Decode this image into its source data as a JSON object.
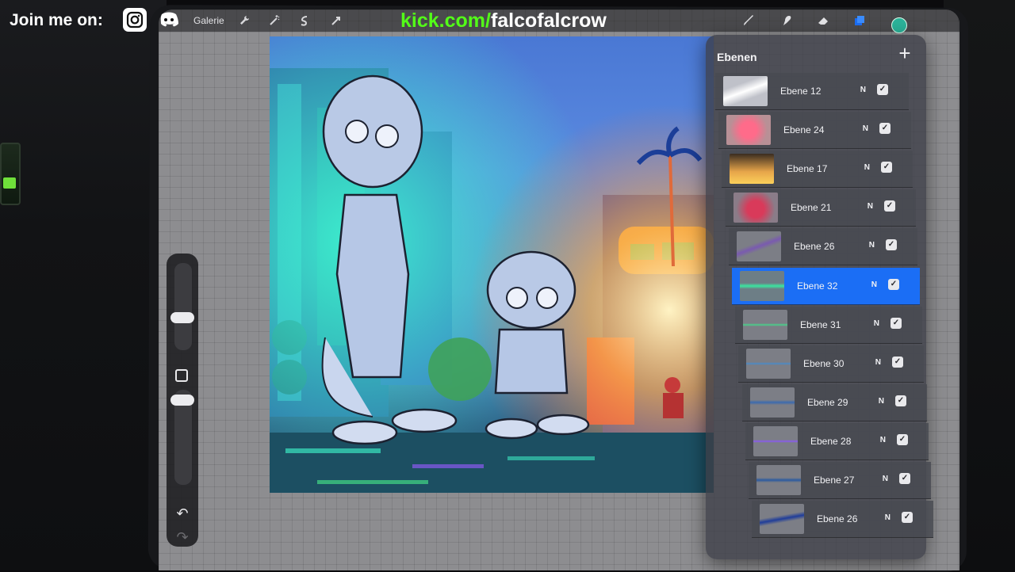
{
  "overlay": {
    "join_label": "Join me on:",
    "kick_domain": "kick.com/",
    "kick_user": "falcofalcrow"
  },
  "toolbar": {
    "gallery_label": "Galerie"
  },
  "layers_panel": {
    "title": "Ebenen",
    "add_label": "+",
    "layers": [
      {
        "name": "Ebene 12",
        "mode": "N",
        "visible": true,
        "selected": false
      },
      {
        "name": "Ebene 24",
        "mode": "N",
        "visible": true,
        "selected": false
      },
      {
        "name": "Ebene 17",
        "mode": "N",
        "visible": true,
        "selected": false
      },
      {
        "name": "Ebene 21",
        "mode": "N",
        "visible": true,
        "selected": false
      },
      {
        "name": "Ebene 26",
        "mode": "N",
        "visible": true,
        "selected": false
      },
      {
        "name": "Ebene 32",
        "mode": "N",
        "visible": true,
        "selected": true
      },
      {
        "name": "Ebene 31",
        "mode": "N",
        "visible": true,
        "selected": false
      },
      {
        "name": "Ebene 30",
        "mode": "N",
        "visible": true,
        "selected": false
      },
      {
        "name": "Ebene 29",
        "mode": "N",
        "visible": true,
        "selected": false
      },
      {
        "name": "Ebene 28",
        "mode": "N",
        "visible": true,
        "selected": false
      },
      {
        "name": "Ebene 27",
        "mode": "N",
        "visible": true,
        "selected": false
      },
      {
        "name": "Ebene 26",
        "mode": "N",
        "visible": true,
        "selected": false
      }
    ]
  },
  "colors": {
    "accent_selected": "#1b6ef5",
    "kick_green": "#53fc18",
    "current_color": "#2bb39a"
  },
  "icons": [
    "instagram-icon",
    "discord-icon",
    "wrench-icon",
    "magic-wand-icon",
    "selection-icon",
    "transform-icon",
    "brush-icon",
    "smudge-icon",
    "eraser-icon",
    "layers-icon",
    "color-icon",
    "undo-icon",
    "redo-icon"
  ]
}
